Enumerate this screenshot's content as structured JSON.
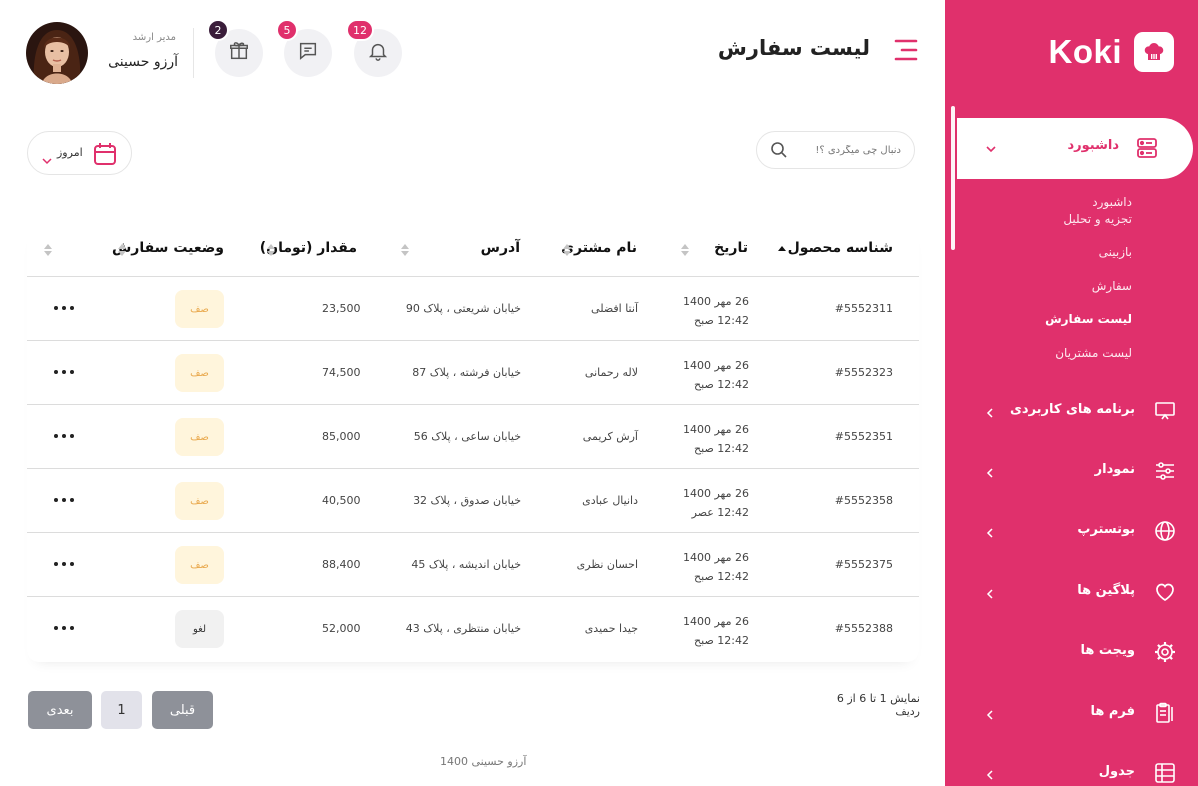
{
  "brand": {
    "name": "Koki",
    "color": "#e0306c"
  },
  "header": {
    "title": "لیست سفارش",
    "user": {
      "name": "آرزو حسینی",
      "role": "مدیر ارشد"
    },
    "notifications": [
      {
        "icon": "bell-icon",
        "count": "12",
        "badge_color": "#e0306c"
      },
      {
        "icon": "chat-icon",
        "count": "5",
        "badge_color": "#e0306c"
      },
      {
        "icon": "gift-icon",
        "count": "2",
        "badge_color": "#3a1d3a"
      }
    ]
  },
  "sidebar": {
    "active": {
      "label": "داشبورد",
      "icon": "dashboard-icon"
    },
    "submenu": [
      "داشبورد",
      "تجزیه و تحلیل",
      "بازبینی",
      "سفارش",
      "لیست سفارش",
      "لیست مشتریان"
    ],
    "active_submenu": "لیست سفارش",
    "items": [
      {
        "label": "برنامه های کاربردی",
        "icon": "monitor-icon"
      },
      {
        "label": "نمودار",
        "icon": "sliders-icon"
      },
      {
        "label": "بوتسترپ",
        "icon": "globe-icon"
      },
      {
        "label": "پلاگین ها",
        "icon": "heart-icon"
      },
      {
        "label": "ویجت ها",
        "icon": "gear-icon"
      },
      {
        "label": "فرم ها",
        "icon": "clipboard-icon"
      },
      {
        "label": "جدول",
        "icon": "table-icon"
      }
    ]
  },
  "toolbar": {
    "search_placeholder": "دنبال چی میگردی ؟!",
    "date_filter": "امروز"
  },
  "table": {
    "headers": {
      "id": "شناسه محصول",
      "date": "تاریخ",
      "customer": "نام مشتری",
      "address": "آدرس",
      "amount": "مقدار (تومان)",
      "status": "وضعیت سفارش"
    },
    "rows": [
      {
        "id": "#5552311",
        "date": "26 مهر 1400",
        "time": "12:42 صبح",
        "customer": "آنتا افضلی",
        "address": "خیابان شریعتی ، پلاک 90",
        "amount": "23,500",
        "status": "صف",
        "status_type": "queue"
      },
      {
        "id": "#5552323",
        "date": "26 مهر 1400",
        "time": "12:42 صبح",
        "customer": "لاله رحمانی",
        "address": "خیابان فرشته ، پلاک 87",
        "amount": "74,500",
        "status": "صف",
        "status_type": "queue"
      },
      {
        "id": "#5552351",
        "date": "26 مهر 1400",
        "time": "12:42 صبح",
        "customer": "آرش کریمی",
        "address": "خیابان ساعی ، پلاک 56",
        "amount": "85,000",
        "status": "صف",
        "status_type": "queue"
      },
      {
        "id": "#5552358",
        "date": "26 مهر 1400",
        "time": "12:42 عصر",
        "customer": "دانیال عبادی",
        "address": "خیابان صدوق ، پلاک 32",
        "amount": "40,500",
        "status": "صف",
        "status_type": "queue"
      },
      {
        "id": "#5552375",
        "date": "26 مهر 1400",
        "time": "12:42 صبح",
        "customer": "احسان نظری",
        "address": "خیابان اندیشه ، پلاک 45",
        "amount": "88,400",
        "status": "صف",
        "status_type": "queue"
      },
      {
        "id": "#5552388",
        "date": "26 مهر 1400",
        "time": "12:42 صبح",
        "customer": "جیدا حمیدی",
        "address": "خیابان منتظری ، پلاک 43",
        "amount": "52,000",
        "status": "لغو",
        "status_type": "cancelled"
      }
    ]
  },
  "pagination": {
    "showing": "نمایش 1 تا 6 از 6 ردیف",
    "prev": "قبلی",
    "page": "1",
    "next": "بعدی"
  },
  "footer": {
    "text": "آرزو حسینی 1400"
  }
}
